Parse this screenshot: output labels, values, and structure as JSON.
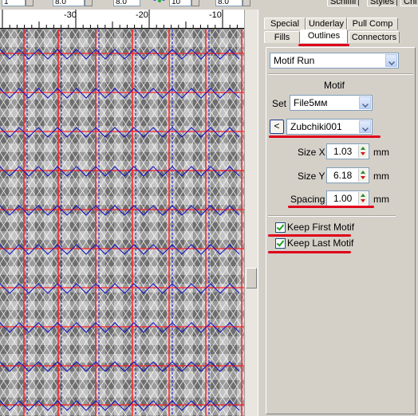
{
  "toolbar": {
    "val1": "1",
    "val2": "8.0",
    "val3": "8.0",
    "val4": "10",
    "val5": "8.0",
    "tab_a": "Schiffli",
    "tab_b": "Styles",
    "tab_c": "Chi"
  },
  "ruler": {
    "ticks": [
      "-30",
      "-20",
      "-10"
    ]
  },
  "tabs": {
    "special": "Special",
    "underlay": "Underlay",
    "pull_comp": "Pull Comp",
    "fills": "Fills",
    "outlines": "Outlines",
    "connectors": "Connectors"
  },
  "outline_type": "Motif Run",
  "motif": {
    "section_title": "Motif",
    "set_label": "Set",
    "set_value": "File5мм",
    "prev_button": "<",
    "motif_value": "Zubchiki001",
    "size_x_label": "Size X",
    "size_x_value": "1.03",
    "size_y_label": "Size Y",
    "size_y_value": "6.18",
    "spacing_label": "Spacing",
    "spacing_value": "1.00",
    "unit": "mm"
  },
  "options": {
    "keep_first": "Keep First Motif",
    "keep_last": "Keep Last Motif"
  },
  "colors": {
    "highlight": "#e0001a",
    "grid_red": "#ff2020",
    "grid_blue": "#1010c0"
  }
}
